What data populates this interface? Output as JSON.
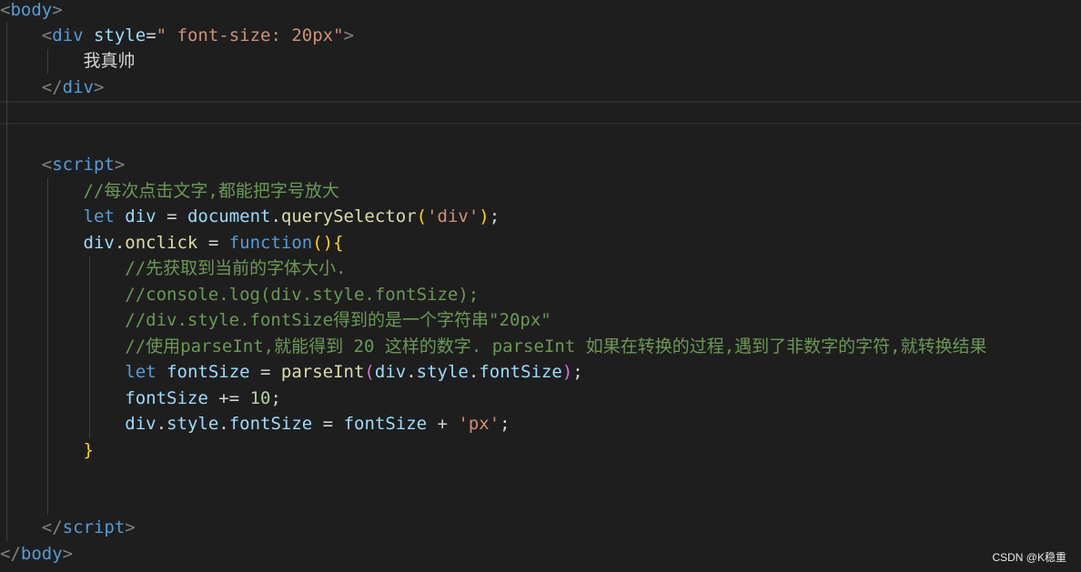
{
  "code": {
    "l1": {
      "t0": "<",
      "t1": "body",
      "t2": ">"
    },
    "l2": {
      "indent": "    ",
      "t0": "<",
      "t1": "div",
      "t2": " style",
      "t3": "=",
      "t4": "\" font-size: 20px\"",
      "t5": ">"
    },
    "l3": {
      "indent": "        ",
      "text": "我真帅"
    },
    "l4": {
      "indent": "    ",
      "t0": "</",
      "t1": "div",
      "t2": ">"
    },
    "l7": {
      "indent": "    ",
      "t0": "<",
      "t1": "script",
      "t2": ">"
    },
    "l8": {
      "indent": "        ",
      "comment": "//每次点击文字,都能把字号放大"
    },
    "l9": {
      "indent": "        ",
      "kw": "let",
      "sp1": " ",
      "var": "div",
      "op": " = ",
      "obj": "document",
      "dot": ".",
      "fn": "querySelector",
      "p1": "(",
      "str": "'div'",
      "p2": ")",
      "semi": ";"
    },
    "l10": {
      "indent": "        ",
      "obj": "div",
      "dot": ".",
      "prop": "onclick",
      "op": " = ",
      "kw": "function",
      "p1": "()",
      "b": "{"
    },
    "l11": {
      "indent": "            ",
      "comment": "//先获取到当前的字体大小."
    },
    "l12": {
      "indent": "            ",
      "comment": "//console.log(div.style.fontSize);"
    },
    "l13": {
      "indent": "            ",
      "comment": "//div.style.fontSize得到的是一个字符串\"20px\""
    },
    "l14": {
      "indent": "            ",
      "comment": "//使用parseInt,就能得到 20 这样的数字. parseInt 如果在转换的过程,遇到了非数字的字符,就转换结果"
    },
    "l15": {
      "indent": "            ",
      "kw": "let",
      "sp1": " ",
      "var": "fontSize",
      "op": " = ",
      "fn": "parseInt",
      "p1": "(",
      "a1": "div",
      "d1": ".",
      "a2": "style",
      "d2": ".",
      "a3": "fontSize",
      "p2": ")",
      "semi": ";"
    },
    "l16": {
      "indent": "            ",
      "var": "fontSize",
      "op": " += ",
      "num": "10",
      "semi": ";"
    },
    "l17": {
      "indent": "            ",
      "a1": "div",
      "d1": ".",
      "a2": "style",
      "d2": ".",
      "a3": "fontSize",
      "op": " = ",
      "var": "fontSize",
      "op2": " + ",
      "str": "'px'",
      "semi": ";"
    },
    "l18": {
      "indent": "        ",
      "b": "}"
    },
    "l21": {
      "indent": "    ",
      "t0": "</",
      "t1": "script",
      "t2": ">"
    },
    "l22": {
      "t0": "</",
      "t1": "body",
      "t2": ">"
    }
  },
  "watermark": "CSDN @K稳重",
  "colors": {
    "background": "#1e1e1e",
    "tag": "#569cd6",
    "attribute": "#9cdcfe",
    "string": "#ce9178",
    "comment": "#6a9955",
    "function": "#dcdcaa",
    "number": "#b5cea8",
    "bracket_gold": "#ffd700",
    "bracket_purple": "#da70d6"
  }
}
